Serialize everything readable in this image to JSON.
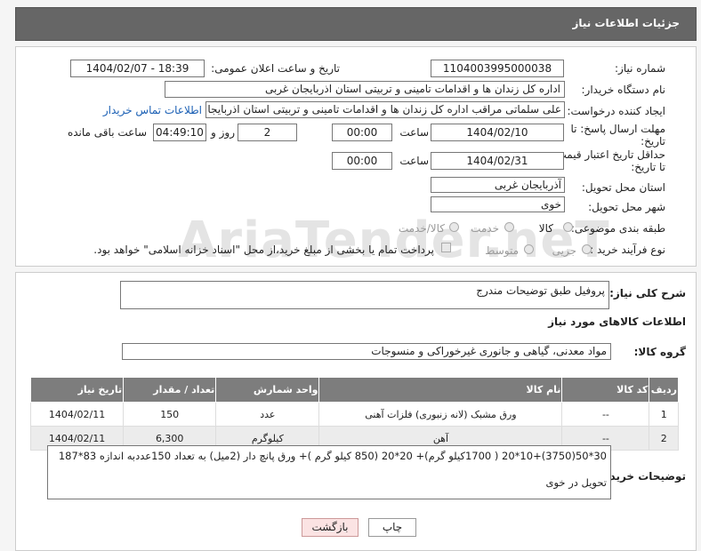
{
  "header": {
    "title": "جزئیات اطلاعات نیاز"
  },
  "watermark": "AriaTender.neT",
  "fields": {
    "need_number_label": "شماره نیاز:",
    "need_number": "1104003995000038",
    "announce_label": "تاریخ و ساعت اعلان عمومی:",
    "announce_value": "1404/02/07 - 18:39",
    "buyer_org_label": "نام دستگاه خریدار:",
    "buyer_org": "اداره کل زندان ها و اقدامات تامینی و تربیتی استان اذربایجان غربی",
    "creator_label": "ایجاد کننده درخواست:",
    "creator": "علی سلماتی مراقب اداره کل زندان ها و اقدامات تامینی و تربیتی استان اذربایجا",
    "contact_link": "اطلاعات تماس خریدار",
    "deadline_label_1": "مهلت ارسال پاسخ: تا",
    "deadline_label_2": "تاریخ:",
    "deadline_date": "1404/02/10",
    "time_label": "ساعت",
    "deadline_time": "00:00",
    "days_value": "2",
    "days_label": "روز و",
    "remaining_time": "04:49:10",
    "remaining_label": "ساعت باقی مانده",
    "validity_label_1": "حداقل تاریخ اعتبار قیمت:",
    "validity_label_2": "تا تاریخ:",
    "validity_date": "1404/02/31",
    "validity_time": "00:00",
    "province_label": "استان محل تحویل:",
    "province": "آذربایجان غربی",
    "city_label": "شهر محل تحویل:",
    "city": "خوی",
    "category_label": "طبقه بندی موضوعی:",
    "category_options": [
      "کالا",
      "خدمت",
      "کالا/خدمت"
    ],
    "process_label": "نوع فرآیند خرید :",
    "process_options": [
      "جزیی",
      "متوسط"
    ],
    "payment_note": "پرداخت تمام یا بخشی از مبلغ خرید،از محل \"اسناد خزانه اسلامی\" خواهد بود."
  },
  "description": {
    "label": "شرح کلی نیاز:",
    "value": "پروفیل طبق توضیحات مندرج"
  },
  "goods": {
    "section_title": "اطلاعات کالاهای مورد نیاز",
    "group_label": "گروه کالا:",
    "group_value": "مواد معدنی، گیاهی و جانوری غیرخوراکی و منسوجات",
    "headers": [
      "ردیف",
      "کد کالا",
      "نام کالا",
      "واحد شمارش",
      "تعداد / مقدار",
      "تاریخ نیاز"
    ],
    "rows": [
      {
        "idx": "1",
        "code": "--",
        "name": "ورق مشبک (لانه زنبوری) فلزات آهنی",
        "unit": "عدد",
        "qty": "150",
        "date": "1404/02/11"
      },
      {
        "idx": "2",
        "code": "--",
        "name": "آهن",
        "unit": "کیلوگرم",
        "qty": "6,300",
        "date": "1404/02/11"
      }
    ]
  },
  "buyer_notes": {
    "label": "توضیحات خریدار:",
    "line1": "30*50(3750)+10*20 ( 1700کیلو گرم)+ 20*20 (850 کیلو گرم )+ ورق پانچ دار (2میل) به تعداد  150عددبه اندازه 83*187",
    "line2": "تحویل در خوی"
  },
  "buttons": {
    "print": "چاپ",
    "back": "بازگشت"
  }
}
